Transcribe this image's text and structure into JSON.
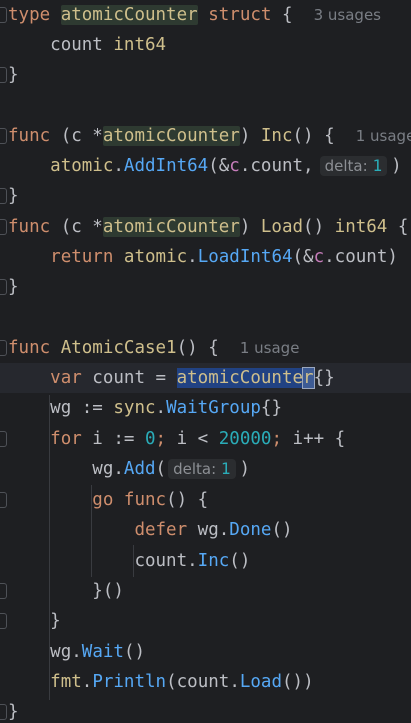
{
  "editor": {
    "l1": {
      "kw_type": "type",
      "name": "atomicCounter",
      "kw_struct": "struct",
      "brace": " {",
      "usages": "3 usages"
    },
    "l2": {
      "field": "count",
      "type": "int64"
    },
    "l3": {
      "brace": "}"
    },
    "l5": {
      "kw_func": "func",
      "recv_open": " (c *",
      "recv_type": "atomicCounter",
      "recv_close": ") ",
      "name": "Inc",
      "sig": "() {",
      "usages": "1 usage"
    },
    "l6": {
      "pkg": "atomic",
      "dot": ".",
      "call": "AddInt64",
      "args": "(&",
      "recv": "c",
      "rest": ".count,",
      "hint_label": "delta:",
      "hint_value": "1",
      "close": ")"
    },
    "l7": {
      "brace": "}"
    },
    "l8": {
      "kw_func": "func",
      "recv_open": " (c *",
      "recv_type": "atomicCounter",
      "recv_close": ") ",
      "name": "Load",
      "sig": "() ",
      "ret": "int64",
      "brace": " {"
    },
    "l9": {
      "kw_return": "return",
      "pkg": "atomic",
      "dot": ".",
      "call": "LoadInt64",
      "args": "(&",
      "recv": "c",
      "rest": ".count)"
    },
    "l10": {
      "brace": "}"
    },
    "l12": {
      "kw_func": "func",
      "name": "AtomicCase1",
      "sig": "() {",
      "usages": "1 usage"
    },
    "l13": {
      "kw_var": "var",
      "ident": " count = ",
      "type_sel": "atomicCounte",
      "caret_char": "r",
      "rest": "{}"
    },
    "l14": {
      "ident": "wg := ",
      "pkg": "sync",
      "dot": ".",
      "type": "WaitGroup",
      "rest": "{}"
    },
    "l15": {
      "kw_for": "for",
      "a": " i := ",
      "n0": "0",
      "b": "; i < ",
      "n1": "20000",
      "c": "; i++ {"
    },
    "l16": {
      "obj": "wg",
      "dot": ".",
      "call": "Add",
      "open": "(",
      "hint_label": "delta:",
      "hint_value": "1",
      "close": ")"
    },
    "l17": {
      "kw_go": "go",
      "kw_func": "func",
      "rest": "() {"
    },
    "l18": {
      "kw_defer": "defer",
      "obj": "wg",
      "dot": ".",
      "call": "Done",
      "rest": "()"
    },
    "l19": {
      "obj": "count",
      "dot": ".",
      "call": "Inc",
      "rest": "()"
    },
    "l20": {
      "text": "}()"
    },
    "l21": {
      "text": "}"
    },
    "l22": {
      "obj": "wg",
      "dot": ".",
      "call": "Wait",
      "rest": "()"
    },
    "l23": {
      "pkg": "fmt",
      "dot": ".",
      "call": "Println",
      "open": "(",
      "obj": "count",
      "dot2": ".",
      "call2": "Load",
      "rest": "())"
    },
    "l24": {
      "brace": "}"
    }
  },
  "colors": {
    "background": "#1e1f22",
    "keyword": "#cf8e6d",
    "type": "#cfbf8c",
    "function": "#56a8f5",
    "number": "#2aacb8",
    "selection": "#214283",
    "hint": "#7a7e85"
  }
}
